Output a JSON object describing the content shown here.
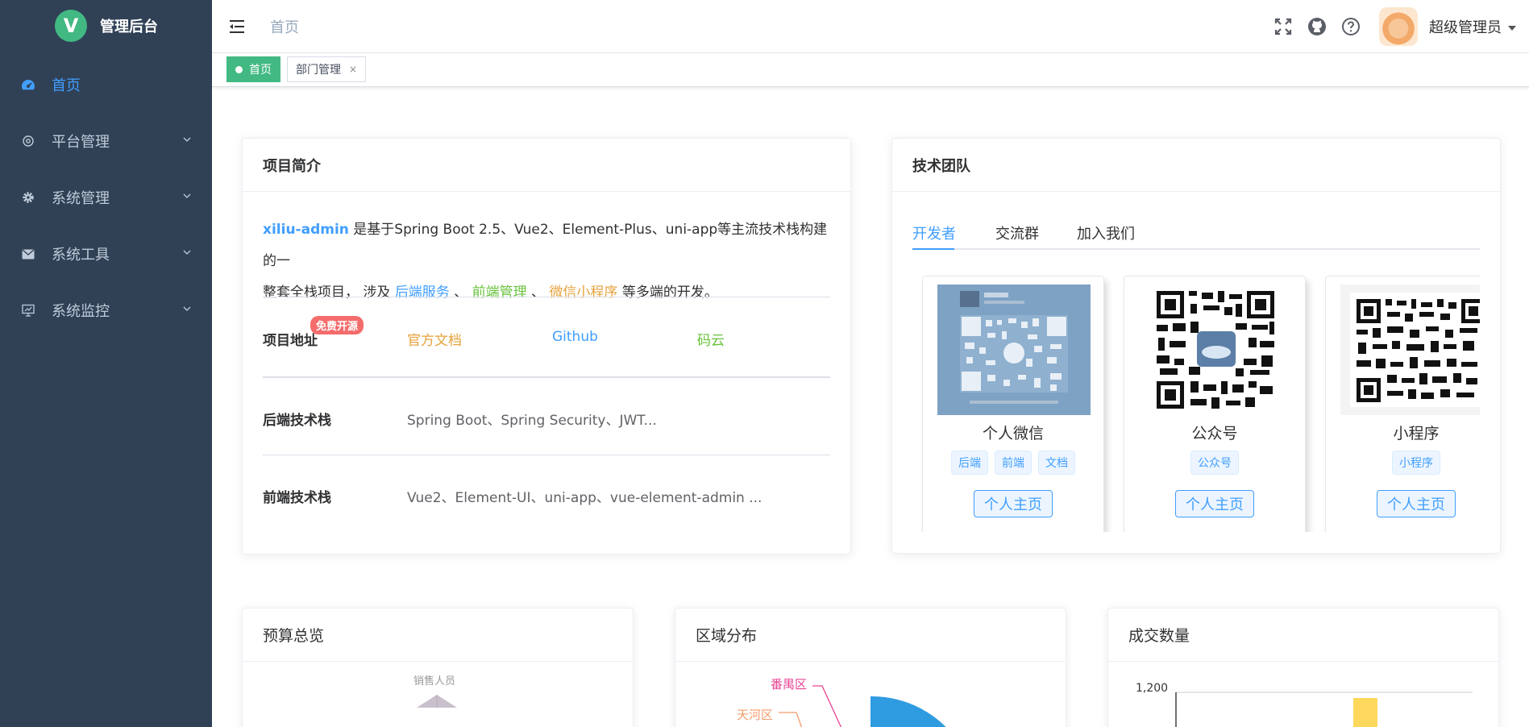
{
  "sidebar": {
    "logo_letter": "V",
    "title": "管理后台",
    "items": [
      {
        "label": "首页",
        "icon": "dashboard-icon",
        "active": true
      },
      {
        "label": "平台管理",
        "icon": "platform-icon"
      },
      {
        "label": "系统管理",
        "icon": "gear-icon"
      },
      {
        "label": "系统工具",
        "icon": "mail-icon"
      },
      {
        "label": "系统监控",
        "icon": "monitor-icon"
      }
    ]
  },
  "navbar": {
    "breadcrumb": "首页",
    "user_name": "超级管理员"
  },
  "tags_view": {
    "active_tag": "首页",
    "second_tag": "部门管理",
    "close_glyph": "×"
  },
  "intro": {
    "header": "项目简介",
    "brand": "xiliu-admin",
    "text1": "是基于Spring Boot 2.5、Vue2、Element-Plus、uni-app等主流技术栈构建的一",
    "text2": "整套全栈项目， 涉及",
    "link_backend": "后端服务",
    "sep1": "、",
    "link_frontend": "前端管理",
    "sep2": "、",
    "link_miniapp": "微信小程序",
    "text3": "等多端的开发。",
    "badge": "免费开源",
    "address_label": "项目地址",
    "address_links": [
      "官方文档",
      "Github",
      "码云"
    ],
    "backend_label": "后端技术栈",
    "backend_value": "Spring Boot、Spring Security、JWT...",
    "frontend_label": "前端技术栈",
    "frontend_value": "Vue2、Element-UI、uni-app、vue-element-admin ..."
  },
  "team": {
    "header": "技术团队",
    "tabs": [
      "开发者",
      "交流群",
      "加入我们"
    ],
    "people": [
      {
        "name": "个人微信",
        "tags": [
          "后端",
          "前端",
          "文档"
        ],
        "button": "个人主页"
      },
      {
        "name": "公众号",
        "tags": [
          "公众号"
        ],
        "button": "个人主页"
      },
      {
        "name": "小程序",
        "tags": [
          "小程序"
        ],
        "button": "个人主页"
      }
    ]
  },
  "bottom_cards": {
    "budget": {
      "header": "预算总览",
      "chart_label": "销售人员"
    },
    "region": {
      "header": "区域分布",
      "labels": [
        "番禺区",
        "天河区"
      ]
    },
    "deals": {
      "header": "成交数量",
      "tick": "1,200"
    }
  },
  "colors": {
    "sidebar_bg": "#304156",
    "accent_blue": "#409eff",
    "tag_green": "#42b983",
    "badge_red": "#f56c6c"
  }
}
